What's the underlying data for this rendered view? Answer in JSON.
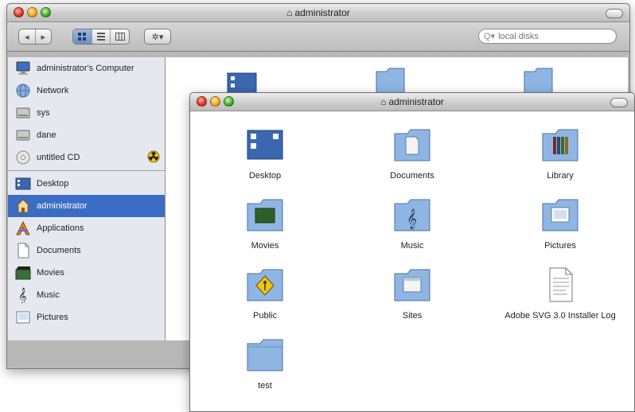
{
  "back_window": {
    "title": "administrator",
    "search_placeholder": "local disks",
    "toolbar": {
      "back": "◂",
      "forward": "▸",
      "action": "✲▾"
    },
    "sidebar": {
      "devices": [
        {
          "label": "administrator's Computer",
          "icon": "computer-icon"
        },
        {
          "label": "Network",
          "icon": "network-icon"
        },
        {
          "label": "sys",
          "icon": "hard-disk-icon"
        },
        {
          "label": "dane",
          "icon": "hard-disk-icon"
        },
        {
          "label": "untitled CD",
          "icon": "cd-icon"
        }
      ],
      "places": [
        {
          "label": "Desktop",
          "icon": "desktop-icon"
        },
        {
          "label": "administrator",
          "icon": "home-icon",
          "selected": true
        },
        {
          "label": "Applications",
          "icon": "applications-icon"
        },
        {
          "label": "Documents",
          "icon": "documents-icon"
        },
        {
          "label": "Movies",
          "icon": "movies-icon"
        },
        {
          "label": "Music",
          "icon": "music-icon"
        },
        {
          "label": "Pictures",
          "icon": "pictures-icon"
        }
      ]
    }
  },
  "front_window": {
    "title": "administrator",
    "items": [
      {
        "label": "Desktop",
        "icon": "desktop-folder-icon"
      },
      {
        "label": "Documents",
        "icon": "documents-folder-icon"
      },
      {
        "label": "Library",
        "icon": "library-folder-icon"
      },
      {
        "label": "Movies",
        "icon": "movies-folder-icon"
      },
      {
        "label": "Music",
        "icon": "music-folder-icon"
      },
      {
        "label": "Pictures",
        "icon": "pictures-folder-icon"
      },
      {
        "label": "Public",
        "icon": "public-folder-icon"
      },
      {
        "label": "Sites",
        "icon": "sites-folder-icon"
      },
      {
        "label": "Adobe SVG 3.0 Installer Log",
        "icon": "text-document-icon"
      },
      {
        "label": "test",
        "icon": "folder-icon"
      }
    ]
  },
  "colors": {
    "selection": "#3c6dc5",
    "sidebar": "#e5e9ef",
    "folder": "#8fb6e3"
  }
}
